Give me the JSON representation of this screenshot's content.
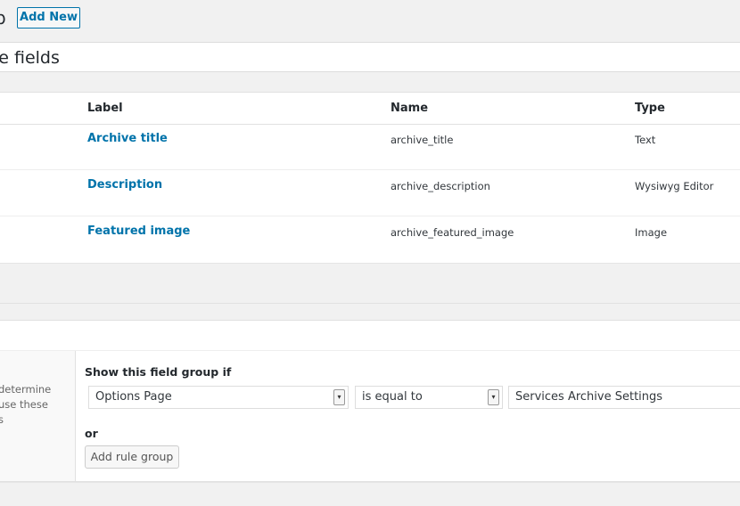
{
  "header": {
    "title": "p",
    "add_new": "Add New"
  },
  "title_input": {
    "value": "ve fields"
  },
  "fields_table": {
    "headers": {
      "label": "Label",
      "name": "Name",
      "type": "Type"
    },
    "rows": [
      {
        "label": "Archive title",
        "name": "archive_title",
        "type": "Text"
      },
      {
        "label": "Description",
        "name": "archive_description",
        "type": "Wysiwyg Editor"
      },
      {
        "label": "Featured image",
        "name": "archive_featured_image",
        "type": "Image"
      }
    ]
  },
  "location": {
    "side_text": [
      "determine",
      "use these",
      "s"
    ],
    "show_if_label": "Show this field group if",
    "rule": {
      "param": "Options Page",
      "operator": "is equal to",
      "value": "Services Archive Settings"
    },
    "or_label": "or",
    "add_rule_group": "Add rule group"
  }
}
